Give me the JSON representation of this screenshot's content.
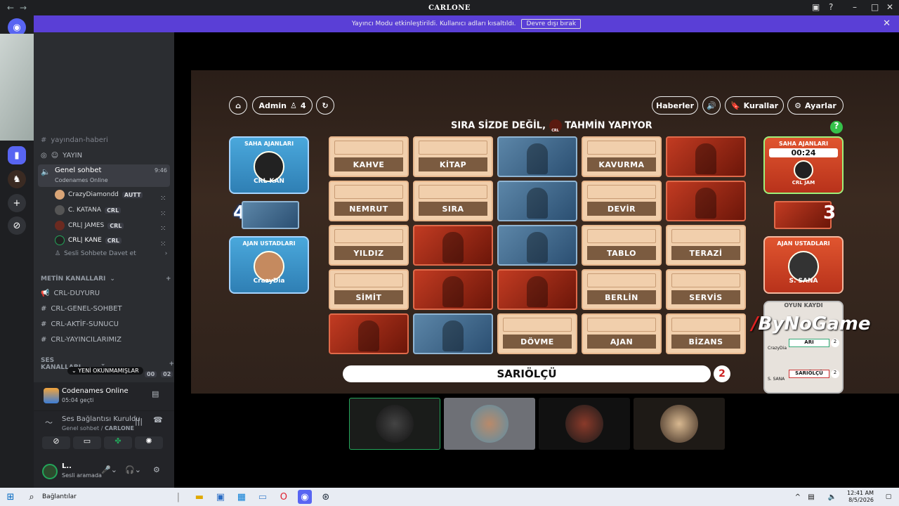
{
  "window": {
    "title": "CARLONE"
  },
  "banner": {
    "text": "Yayıncı Modu etkinleştirildi. Kullanıcı adları kısaltıldı.",
    "button": "Devre dışı bırak"
  },
  "sidebar": {
    "partial_channel": "yayından-haberi",
    "yayin_channel": "YAYIN",
    "voice_channel": {
      "name": "Genel sohbet",
      "time": "9:46",
      "activity": "Codenames Online"
    },
    "voice_users": [
      {
        "name": "CrazyDiamondd",
        "tag": "AUTT"
      },
      {
        "name": "C. KATANA",
        "tag": "CRL"
      },
      {
        "name": "CRL| JAMES",
        "tag": "CRL"
      },
      {
        "name": "CRL| KANE",
        "tag": "CRL"
      }
    ],
    "invite": "Sesli Sohbete Davet et",
    "text_category": "METİN KANALLARI",
    "text_channels": [
      "CRL-DUYURU",
      "CRL-GENEL-SOHBET",
      "CRL-AKTİF-SUNUCU",
      "CRL-YAYINCILARIMIZ"
    ],
    "voice_category": "SES KANALLARI",
    "unread_pill": "YENİ OKUNMAMIŞLAR",
    "voice_row_counts": [
      "00",
      "02"
    ],
    "activity": {
      "title": "Codenames Online",
      "sub": "05:04 geçti"
    },
    "connection": {
      "title": "Ses Bağlantısı Kuruldu",
      "sub_prefix": "Genel sohbet / ",
      "sub_server": "CARLONE"
    },
    "user": {
      "name": "L..",
      "status": "Sesli aramada"
    }
  },
  "game": {
    "top_buttons": {
      "admin": "Admin",
      "player_count": "4",
      "news": "Haberler",
      "rules": "Kurallar",
      "settings": "Ayarlar"
    },
    "turn_text_before": "SIRA SİZDE DEĞİL,",
    "turn_text_after": "TAHMİN YAPIYOR",
    "turn_avatar_label": "CRL JAM",
    "blue_team": {
      "operatives_label": "SAHA AJANLARI",
      "operative": "CRL KAN",
      "count": "4",
      "spymasters_label": "AJAN USTADLARI",
      "spymaster": "CrazyDia"
    },
    "red_team": {
      "operatives_label": "SAHA AJANLARI",
      "timer": "00:24",
      "operative": "CRL JAM",
      "count": "3",
      "spymasters_label": "AJAN USTADLARI",
      "spymaster": "S. SANA"
    },
    "grid": [
      {
        "type": "word",
        "text": "KAHVE"
      },
      {
        "type": "word",
        "text": "KİTAP"
      },
      {
        "type": "blue"
      },
      {
        "type": "word",
        "text": "KAVURMA"
      },
      {
        "type": "red"
      },
      {
        "type": "word",
        "text": "NEMRUT"
      },
      {
        "type": "word",
        "text": "SIRA"
      },
      {
        "type": "blue"
      },
      {
        "type": "word",
        "text": "DEVİR"
      },
      {
        "type": "red"
      },
      {
        "type": "word",
        "text": "YILDIZ"
      },
      {
        "type": "red"
      },
      {
        "type": "blue"
      },
      {
        "type": "word",
        "text": "TABLO"
      },
      {
        "type": "word",
        "text": "TERAZİ"
      },
      {
        "type": "word",
        "text": "SİMİT"
      },
      {
        "type": "red"
      },
      {
        "type": "red"
      },
      {
        "type": "word",
        "text": "BERLİN"
      },
      {
        "type": "word",
        "text": "SERVİS"
      },
      {
        "type": "red"
      },
      {
        "type": "blue"
      },
      {
        "type": "word",
        "text": "DÖVME"
      },
      {
        "type": "word",
        "text": "AJAN"
      },
      {
        "type": "word",
        "text": "BİZANS"
      }
    ],
    "clue": {
      "word": "SARIÖLÇÜ",
      "number": "2"
    },
    "game_log": {
      "title": "OYUN KAYDI",
      "entries": [
        {
          "word": "ARI",
          "num": "2"
        },
        {
          "word": "SARIÖLÇÜ",
          "num": "2"
        }
      ],
      "user_a": "CrazyDia",
      "user_b": "S. SANA"
    },
    "watermark": "ByNoGame"
  },
  "taskbar": {
    "search_label": "Bağlantılar",
    "time": "12:41 AM",
    "date": "8/5/2026"
  },
  "colors": {
    "accent": "#5a3fd6",
    "blue_team": "#3a96cf",
    "red_team": "#d54726"
  }
}
